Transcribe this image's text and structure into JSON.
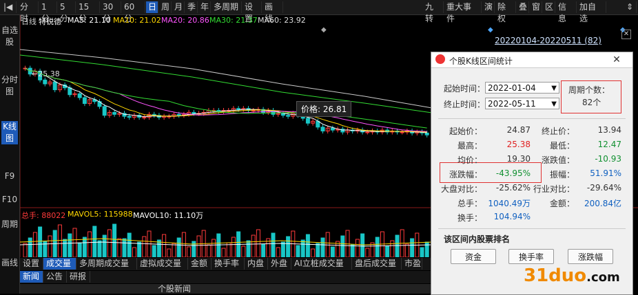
{
  "colors": {
    "up": "#ff3b3b",
    "down": "#19c6c6",
    "ma5": "#ffffff",
    "ma10": "#ffd700",
    "ma20": "#ff55ff",
    "ma30": "#33dd33",
    "ma60": "#cccccc",
    "accent": "#1e5bb8"
  },
  "toolbar": {
    "left": [
      "分时",
      "1分",
      "5分",
      "15分",
      "30分",
      "60分",
      "日",
      "周",
      "月",
      "季",
      "年",
      "多周期",
      "设置",
      "画线"
    ],
    "right": [
      "九转",
      "重大事件",
      "演",
      "除权",
      "叠",
      "窗",
      "区",
      "信息",
      "加自选"
    ]
  },
  "sidebar": [
    "自选股",
    "分时图",
    "K线图",
    "F9",
    "F10",
    "周期",
    "画线"
  ],
  "chart": {
    "period": "日线",
    "name": "特锐德",
    "ma5": "MA5: 21.10",
    "ma10": "MA10: 21.02",
    "ma20": "MA20: 20.86",
    "ma30": "MA30: 21.37",
    "ma60": "MA60: 23.92",
    "range_label": "20220104-20220511 (82)",
    "high_mark": "25.38",
    "price_tip": "价格: 26.81",
    "vol_label": "总手: 88022",
    "mavol5": "MAVOL5: 115988",
    "mavol10": "MAVOL10: 11.10万",
    "tabs": [
      "设置",
      "成交量",
      "多周期成交量",
      "虚拟成交量",
      "金额",
      "换手率",
      "内盘",
      "外盘",
      "AI立桩成交量",
      "盘后成交量",
      "市盈"
    ],
    "news_tabs": [
      "新闻",
      "公告",
      "研报"
    ],
    "news_title": "个股新闻"
  },
  "dialog": {
    "title": "个股K线区间统计",
    "start_label": "起始时间：",
    "start_value": "2022-01-04",
    "end_label": "终止时间：",
    "end_value": "2022-05-11",
    "period_label": "周期个数：",
    "period_value": "82个",
    "stats": [
      {
        "l": "起始价：",
        "v": "24.87",
        "l2": "终止价：",
        "v2": "13.94"
      },
      {
        "l": "最高：",
        "v": "25.38",
        "l2": "最低：",
        "v2": "12.47"
      },
      {
        "l": "均价：",
        "v": "19.30",
        "l2": "涨跌值：",
        "v2": "-10.93"
      },
      {
        "l": "涨跌幅：",
        "v": "-43.95%",
        "l2": "振幅：",
        "v2": "51.91%"
      },
      {
        "l": "大盘对比：",
        "v": "-25.62%",
        "l2": "行业对比：",
        "v2": "-29.64%"
      },
      {
        "l": "总手：",
        "v": "1040.49万",
        "l2": "金额：",
        "v2": "200.84亿"
      },
      {
        "l": "换手：",
        "v": "104.94%",
        "l2": "",
        "v2": ""
      }
    ],
    "rank_title": "该区间内股票排名",
    "buttons": [
      "资金",
      "换手率",
      "涨跌幅"
    ]
  },
  "watermark": {
    "brand": "31duo",
    "suffix": ".com"
  }
}
